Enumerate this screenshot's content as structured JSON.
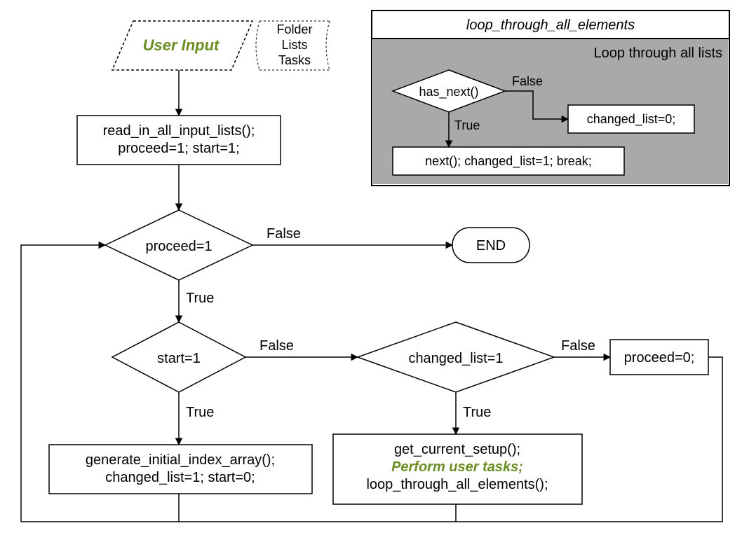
{
  "main": {
    "userInput": "User Input",
    "folder": "Folder",
    "lists": "Lists",
    "tasks": "Tasks",
    "readIn1": "read_in_all_input_lists();",
    "readIn2": "proceed=1; start=1;",
    "proceed": "proceed=1",
    "start": "start=1",
    "changedList": "changed_list=1",
    "proceed0": "proceed=0;",
    "end": "END",
    "gen1": "generate_initial_index_array();",
    "gen2": "changed_list=1; start=0;",
    "get1": "get_current_setup();",
    "get2": "Perform user tasks;",
    "get3": "loop_through_all_elements();",
    "true": "True",
    "false": "False"
  },
  "inset": {
    "title": "loop_through_all_elements",
    "subtitle": "Loop through all lists",
    "hasNext": "has_next()",
    "next": "next(); changed_list=1; break;",
    "changed0": "changed_list=0;",
    "true": "True",
    "false": "False"
  }
}
